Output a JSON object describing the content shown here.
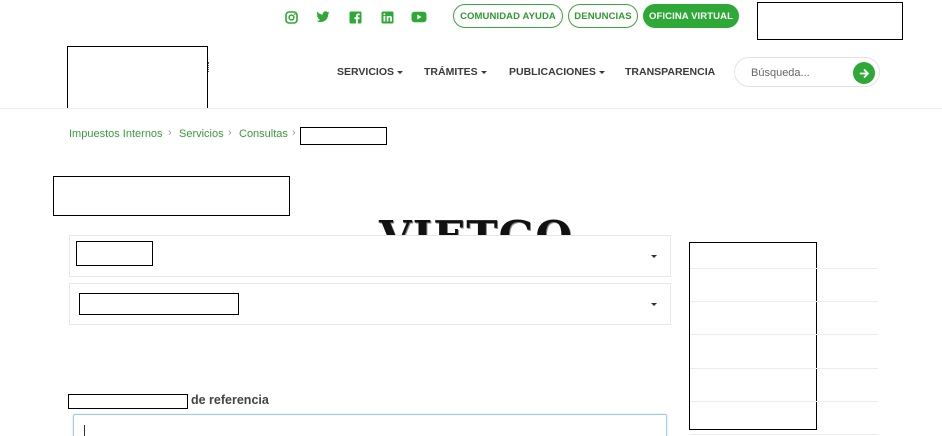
{
  "topbar": {
    "social": [
      "instagram-icon",
      "twitter-icon",
      "facebook-icon",
      "linkedin-icon",
      "youtube-icon"
    ],
    "links": [
      "COMUNIDAD AYUDA",
      "DENUNCIAS",
      "OFICINA VIRTUAL"
    ]
  },
  "nav": {
    "items": [
      "SERVICIOS",
      "TRÁMITES",
      "PUBLICACIONES",
      "TRANSPARENCIA"
    ],
    "search_placeholder": "Búsqueda..."
  },
  "breadcrumb": [
    "Impuestos Internos",
    "Servicios",
    "Consultas"
  ],
  "watermark": "VIETGO",
  "form": {
    "reference_label": "de referencia",
    "reference_value": ""
  },
  "colors": {
    "brand_green": "#2ea836",
    "text_dark": "#3a3a3a",
    "border_light": "#e6e6e6"
  }
}
